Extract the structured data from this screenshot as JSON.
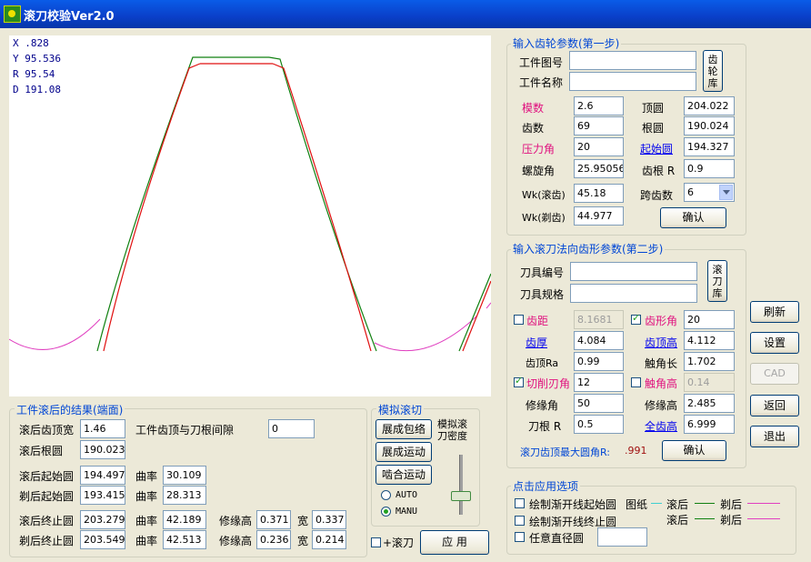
{
  "window": {
    "title": "滚刀校验Ver2.0"
  },
  "readout": {
    "x": "X .828",
    "y": "Y 95.536",
    "r": "R 95.54",
    "d": "D 191.08"
  },
  "step1": {
    "title": "输入齿轮参数(第一步)",
    "part_no_label": "工件图号",
    "part_no": "",
    "part_name_label": "工件名称",
    "part_name": "",
    "gear_lib_btn": "齿轮库",
    "module_label": "模数",
    "module": "2.6",
    "teeth_label": "齿数",
    "teeth": "69",
    "pressure_angle_label": "压力角",
    "pressure_angle": "20",
    "helix_angle_label": "螺旋角",
    "helix_angle": "25.95056",
    "wk_hob_label": "Wk(滚齿)",
    "wk_hob": "45.18",
    "wk_shave_label": "Wk(剃齿)",
    "wk_shave": "44.977",
    "tip_circle_label": "顶圆",
    "tip_circle": "204.022",
    "root_circle_label": "根圆",
    "root_circle": "190.024",
    "start_circle_label": "起始圆",
    "start_circle": "194.327",
    "root_r_label": "齿根 R",
    "root_r": "0.9",
    "span_label": "跨齿数",
    "span": "6",
    "confirm_btn": "确认"
  },
  "step2": {
    "title": "输入滚刀法向齿形参数(第二步)",
    "tool_no_label": "刀具编号",
    "tool_no": "",
    "tool_spec_label": "刀具规格",
    "tool_spec": "",
    "hob_lib_btn": "滚刀库",
    "pitch_label": "齿距",
    "pitch": "8.1681",
    "thickness_label": "齿厚",
    "thickness": "4.084",
    "tip_ra_label": "齿顶Ra",
    "tip_ra": "0.99",
    "cut_angle_label": "切削刃角",
    "cut_angle": "12",
    "mod_angle_label": "修缘角",
    "mod_angle": "50",
    "root_r_label": "刀根 R",
    "root_r": "0.5",
    "profile_angle_label": "齿形角",
    "profile_angle": "20",
    "tip_height_label": "齿顶高",
    "tip_height": "4.112",
    "touch_len_label": "触角长",
    "touch_len": "1.702",
    "touch_height_label": "触角高",
    "touch_height": "0.14",
    "mod_height_label": "修缘高",
    "mod_height": "2.485",
    "full_height_label": "全齿高",
    "full_height": "6.999",
    "max_fillet_label": "滚刀齿顶最大圆角R:",
    "max_fillet": ".991",
    "confirm_btn": "确认"
  },
  "side_buttons": {
    "refresh": "刷新",
    "settings": "设置",
    "cad": "CAD",
    "back": "返回",
    "exit": "退出"
  },
  "results": {
    "title": "工件滚后的结果(端面)",
    "tip_width_label": "滚后齿顶宽",
    "tip_width": "1.46",
    "clearance_label": "工件齿顶与刀根间隙",
    "clearance": "0",
    "root_circle_label": "滚后根圆",
    "root_circle": "190.023",
    "hob_start_label": "滚后起始圆",
    "hob_start": "194.497",
    "hob_start_curv": "30.109",
    "shave_start_label": "剃后起始圆",
    "shave_start": "193.415",
    "shave_start_curv": "28.313",
    "hob_end_label": "滚后终止圆",
    "hob_end": "203.279",
    "hob_end_curv": "42.189",
    "hob_end_mod": "0.371",
    "hob_end_w": "0.337",
    "shave_end_label": "剃后终止圆",
    "shave_end": "203.549",
    "shave_end_curv": "42.513",
    "shave_end_mod": "0.236",
    "shave_end_w": "0.214",
    "curv_label": "曲率",
    "mod_label": "修缘高",
    "width_label": "宽"
  },
  "simulate": {
    "title": "模拟滚切",
    "envelope_btn": "展成包络",
    "motion_btn": "展成运动",
    "mesh_btn": "啮合运动",
    "density_label": "模拟滚刀密度",
    "auto": "AUTO",
    "manu": "MANU",
    "hob_check": "+滚刀",
    "apply_btn": "应 用",
    "density_level": 0.3
  },
  "options": {
    "title": "点击应用选项",
    "start_circle": "绘制渐开线起始圆",
    "end_circle": "绘制渐开线终止圆",
    "any_circle": "任意直径圆",
    "legend_title": "图纸",
    "legend_hob": "滚后",
    "legend_shave": "剃后",
    "any_value": ""
  },
  "colors": {
    "green": "#108010",
    "red": "#e01010",
    "pink": "#e040c0",
    "cyan": "#40d0d0"
  }
}
